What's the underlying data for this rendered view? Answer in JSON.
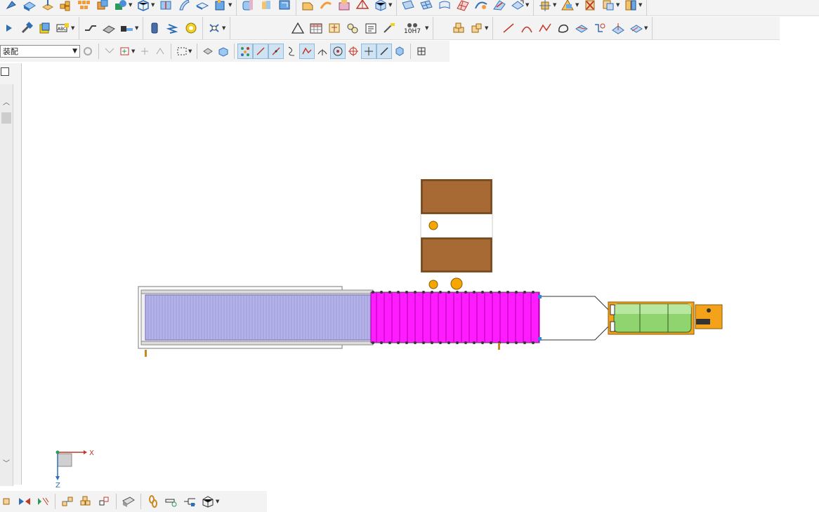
{
  "toolbar": {
    "assembly_combo": {
      "value": "装配"
    },
    "fit_label": "10H7"
  },
  "colors": {
    "accent_blue": "#2f6fb8",
    "conveyor_lavender": "#b5b3e8",
    "conveyor_magenta": "#ff1dff",
    "box_brown": "#a86a34",
    "ball_orange": "#f7a600",
    "drum_green": "#8fd46f",
    "motor_orange": "#f4a21a"
  },
  "viewport": {
    "axis": {
      "x_label": "X",
      "z_label": "Z"
    }
  }
}
